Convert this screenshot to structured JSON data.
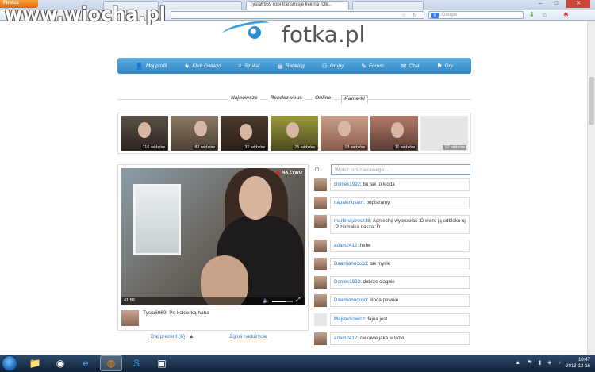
{
  "browser": {
    "app_button": "Firefox",
    "active_tab_title": "Tysia6969 robi transmisje live na fotk...",
    "search_placeholder": "Google"
  },
  "watermark": "www.wiocha.pl",
  "site": {
    "logo_text": "fotka.pl",
    "menu": [
      {
        "label": "Mój profil",
        "icon": "user-icon"
      },
      {
        "label": "Klub Gwiazd",
        "icon": "star-icon"
      },
      {
        "label": "Szukaj",
        "icon": "search-icon"
      },
      {
        "label": "Ranking",
        "icon": "ranking-icon"
      },
      {
        "label": "Grupy",
        "icon": "group-icon"
      },
      {
        "label": "Forum",
        "icon": "pencil-icon"
      },
      {
        "label": "Czat",
        "icon": "chat-icon"
      },
      {
        "label": "Gry",
        "icon": "gamepad-icon"
      }
    ],
    "subtabs": [
      "Najnowsze",
      "Rendez-vous",
      "Online",
      "Kamerki"
    ],
    "thumbnails": [
      {
        "viewers": "116 widzów"
      },
      {
        "viewers": "82 widzów"
      },
      {
        "viewers": "32 widzów"
      },
      {
        "viewers": "25 widzów"
      },
      {
        "viewers": "13 widzów"
      },
      {
        "viewers": "11 widzów"
      },
      {
        "viewers": "12 widzów"
      }
    ]
  },
  "video": {
    "live_label": "NA ŻYWO",
    "time": "41:58",
    "volume": 0.65,
    "caption_user": "Tysia6969:",
    "caption_text": "Po kołderką haha"
  },
  "links": {
    "gift": "Daj prezent (6)",
    "report": "Zgłoś naduzycie"
  },
  "chat": {
    "input_placeholder": "Wpisz coś ciekawego...",
    "messages": [
      {
        "user": "Doniek1992",
        "text": "bo tak to kloda"
      },
      {
        "user": "napalonusam",
        "text": "popiszamy"
      },
      {
        "user": "marbinajarosz18",
        "text": "Agniechę wyprosiłaś :D weze ją odbloku uj :P ziomalka nasza :D"
      },
      {
        "user": "adam2412",
        "text": "hehe"
      },
      {
        "user": "Daamianoooxd",
        "text": "tak mysle"
      },
      {
        "user": "Doniek1992",
        "text": "dobrze ciagnie"
      },
      {
        "user": "Daamianoooxd",
        "text": "kloda pewnie"
      },
      {
        "user": "Majsterkowicz",
        "text": "fajna jest"
      },
      {
        "user": "adam2412",
        "text": "ciekawe jaka w lozku"
      }
    ]
  },
  "taskbar": {
    "time": "18:47",
    "date": "2013-12-16"
  }
}
